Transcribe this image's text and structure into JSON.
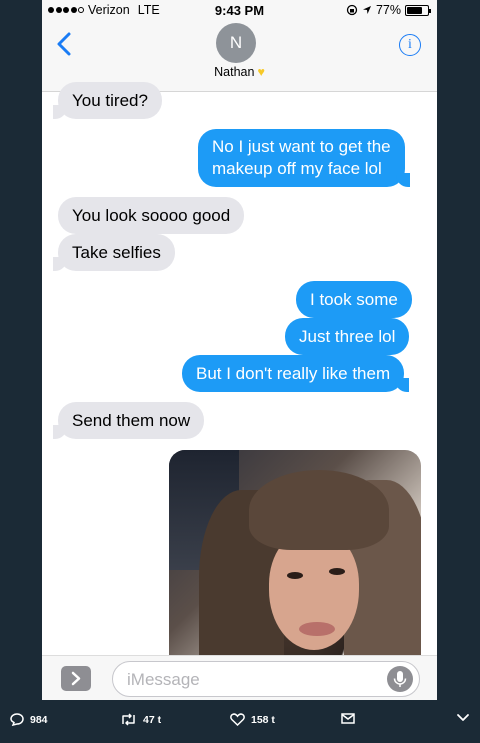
{
  "status_bar": {
    "carrier": "Verizon",
    "network": "LTE",
    "time": "9:43 PM",
    "battery": "77%",
    "battery_level": 0.77
  },
  "header": {
    "avatar_initial": "N",
    "contact_name": "Nathan",
    "info_symbol": "i"
  },
  "messages": [
    {
      "from": "them",
      "text": "You tired?"
    },
    {
      "from": "me",
      "lines": [
        "No I just want to get the",
        "makeup off my face lol"
      ]
    },
    {
      "from": "them",
      "text": "You look soooo good"
    },
    {
      "from": "them",
      "text": "Take selfies"
    },
    {
      "from": "me",
      "text": "I took some"
    },
    {
      "from": "me",
      "text": "Just three lol"
    },
    {
      "from": "me",
      "text": "But I don't really like them"
    },
    {
      "from": "them",
      "text": "Send them now"
    }
  ],
  "input": {
    "placeholder": "iMessage"
  },
  "tweet_actions": {
    "replies": "984",
    "retweets": "47 t",
    "likes": "158 t"
  },
  "colors": {
    "outgoing": "#1d9bf6",
    "incoming": "#e5e5ea",
    "accent": "#1a7cf5",
    "page_bg": "#1b2a36"
  },
  "icons": [
    "back-chevron-icon",
    "info-icon",
    "app-store-icon",
    "microphone-icon",
    "reply-icon",
    "retweet-icon",
    "like-heart-icon",
    "message-envelope-icon",
    "caret-down-icon"
  ]
}
